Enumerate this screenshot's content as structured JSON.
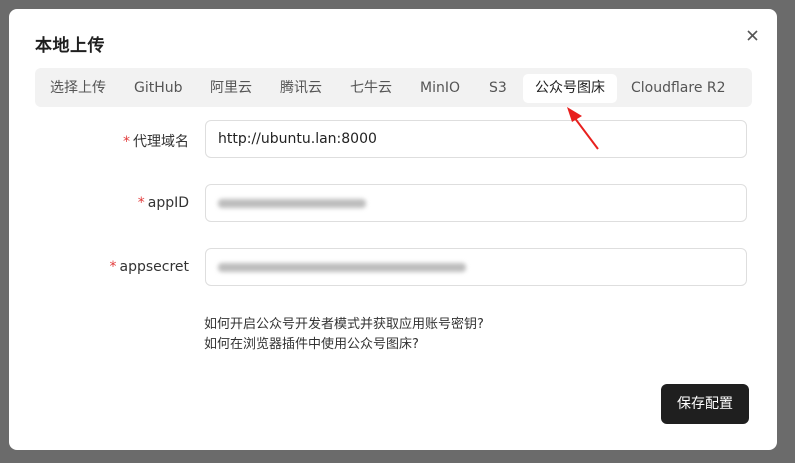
{
  "dialog": {
    "title": "本地上传",
    "close_icon": "close-icon"
  },
  "tabs": [
    {
      "label": "选择上传"
    },
    {
      "label": "GitHub"
    },
    {
      "label": "阿里云"
    },
    {
      "label": "腾讯云"
    },
    {
      "label": "七牛云"
    },
    {
      "label": "MinIO"
    },
    {
      "label": "S3"
    },
    {
      "label": "公众号图床",
      "active": true
    },
    {
      "label": "Cloudflare R2"
    }
  ],
  "form": {
    "required_mark": "*",
    "proxy_domain": {
      "label": "代理域名",
      "value": "http://ubuntu.lan:8000"
    },
    "app_id": {
      "label": "appID"
    },
    "app_secret": {
      "label": "appsecret"
    }
  },
  "help_links": [
    "如何开启公众号开发者模式并获取应用账号密钥?",
    "如何在浏览器插件中使用公众号图床?"
  ],
  "save_button": "保存配置",
  "colors": {
    "accent_dark": "#1f1f1f",
    "required_red": "#e23b3b",
    "annotation_red": "#e8201e"
  }
}
